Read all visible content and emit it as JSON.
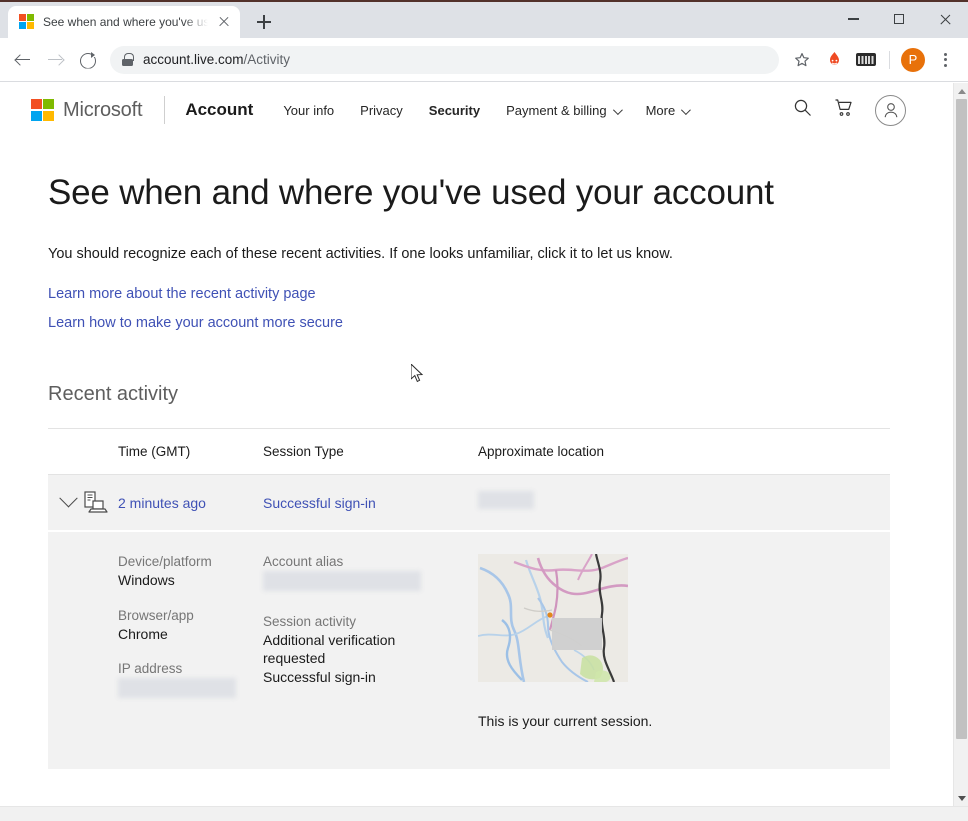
{
  "browser": {
    "tab": {
      "title": "See when and where you've used",
      "favicon": "microsoft-logo-icon",
      "close_label": "×"
    },
    "new_tab_label": "+",
    "window_controls": {
      "minimize": "—",
      "maximize": "□",
      "close": "×"
    },
    "nav": {
      "back": "back-arrow-icon",
      "forward": "forward-arrow-icon",
      "reload": "reload-icon"
    },
    "omnibox": {
      "lock": "lock-icon",
      "url_domain": "account.live.com",
      "url_path": "/Activity"
    },
    "actions": {
      "bookmark": "star-icon",
      "extension_flame": "flame-extension-icon",
      "extension_card": "keyboard-extension-icon",
      "profile_initial": "P",
      "menu": "three-dot-menu-icon"
    }
  },
  "msheader": {
    "logo_text": "Microsoft",
    "brand": "Account",
    "nav_items": [
      {
        "label": "Your info",
        "has_caret": false,
        "active": false
      },
      {
        "label": "Privacy",
        "has_caret": false,
        "active": false
      },
      {
        "label": "Security",
        "has_caret": false,
        "active": true
      },
      {
        "label": "Payment & billing",
        "has_caret": true,
        "active": false
      },
      {
        "label": "More",
        "has_caret": true,
        "active": false
      }
    ],
    "icons": {
      "search": "search-icon",
      "cart": "shopping-cart-icon",
      "account": "person-avatar-icon"
    }
  },
  "main": {
    "title": "See when and where you've used your account",
    "lede": "You should recognize each of these recent activities. If one looks unfamiliar, click it to let us know.",
    "links": [
      "Learn more about the recent activity page",
      "Learn how to make your account more secure"
    ],
    "section_title": "Recent activity",
    "table": {
      "headers": [
        "Time (GMT)",
        "Session Type",
        "Approximate location"
      ],
      "rows": [
        {
          "time": "2 minutes ago",
          "session_type": "Successful sign-in",
          "location_redacted": true,
          "device_icon": "device-desktop-laptop-icon",
          "expanded": true
        }
      ]
    },
    "detail": {
      "device_platform_label": "Device/platform",
      "device_platform_value": "Windows",
      "browser_app_label": "Browser/app",
      "browser_app_value": "Chrome",
      "ip_address_label": "IP address",
      "ip_address_value_redacted": true,
      "account_alias_label": "Account alias",
      "account_alias_value_redacted": true,
      "session_activity_label": "Session activity",
      "session_activity_values": [
        "Additional verification requested",
        "Successful sign-in"
      ],
      "map_caption": "This is your current session."
    }
  },
  "colors": {
    "link": "#3f51b5",
    "brand_red": "#f25022",
    "brand_green": "#7fba00",
    "brand_blue": "#00a4ef",
    "brand_yellow": "#ffb900",
    "profile_orange": "#e8710a",
    "row_bg": "#f2f2f2",
    "map_bg": "#eceae5"
  }
}
